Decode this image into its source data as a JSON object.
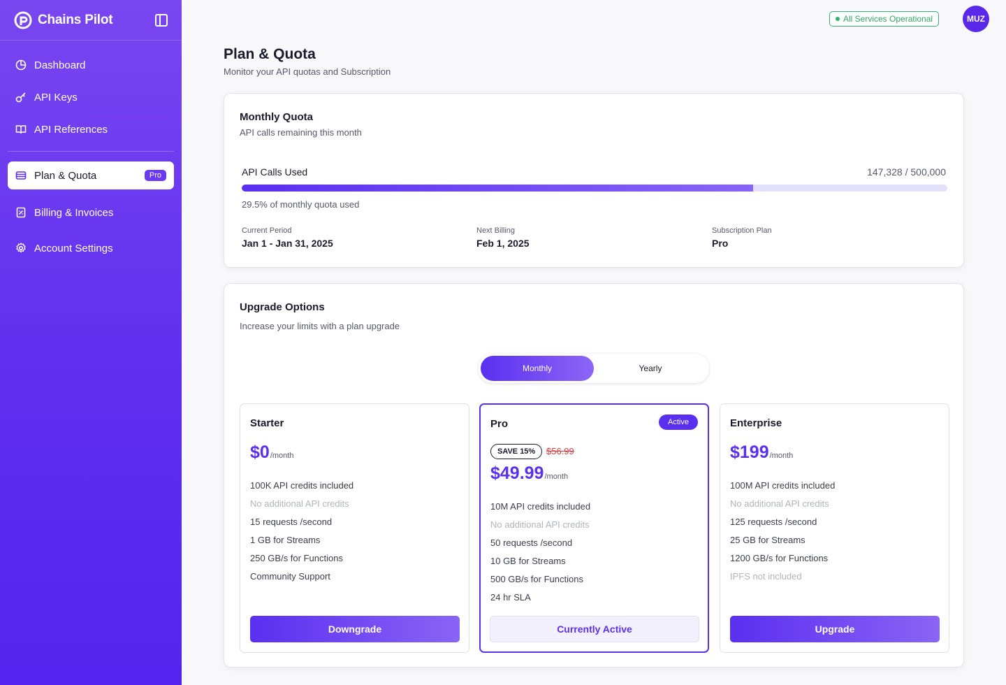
{
  "brand": {
    "name": "Chains Pilot"
  },
  "sidebar": {
    "items": [
      {
        "label": "Dashboard",
        "icon": "dashboard-icon"
      },
      {
        "label": "API Keys",
        "icon": "key-icon"
      },
      {
        "label": "API References",
        "icon": "book-icon"
      }
    ],
    "active_item": {
      "label": "Plan & Quota",
      "badge": "Pro",
      "icon": "plan-icon"
    },
    "items_bottom": [
      {
        "label": "Billing & Invoices",
        "icon": "invoice-icon"
      },
      {
        "label": "Account Settings",
        "icon": "gear-icon"
      }
    ]
  },
  "topbar": {
    "status": "All Services Operational",
    "avatar": "MUZ"
  },
  "header": {
    "title": "Plan & Quota",
    "subtitle": "Monitor your API quotas and Subscription"
  },
  "quota": {
    "title": "Monthly Quota",
    "subtitle": "API calls remaining this month",
    "calls_label": "API Calls Used",
    "calls_value": "147,328 / 500,000",
    "progress_fraction": 0.725,
    "percent_text": "29.5% of monthly quota used",
    "meta": [
      {
        "key": "Current Period",
        "value": "Jan 1 - Jan 31, 2025"
      },
      {
        "key": "Next Billing",
        "value": "Feb 1, 2025"
      },
      {
        "key": "Subscription Plan",
        "value": "Pro"
      }
    ]
  },
  "upgrade": {
    "title": "Upgrade Options",
    "subtitle": "Increase your limits with a plan upgrade",
    "toggle": {
      "monthly": "Monthly",
      "yearly": "Yearly",
      "selected": "Monthly"
    },
    "plans": [
      {
        "name": "Starter",
        "price": "$0",
        "per": "/month",
        "features": [
          "100K API credits included",
          "No additional API credits",
          "15 requests /second",
          "1 GB for Streams",
          "250 GB/s for Functions",
          "Community Support"
        ],
        "button": "Downgrade"
      },
      {
        "name": "Pro",
        "badge": "Active",
        "save": "SAVE 15%",
        "old_price": "$56.99",
        "price": "$49.99",
        "per": "/month",
        "features": [
          "10M API credits included",
          "No additional API credits",
          "50 requests /second",
          "10 GB for Streams",
          "500 GB/s for Functions",
          "24 hr SLA"
        ],
        "button": "Currently Active"
      },
      {
        "name": "Enterprise",
        "price": "$199",
        "per": "/month",
        "features": [
          "100M API credits included",
          "No additional API credits",
          "125 requests /second",
          "25 GB for Streams",
          "1200 GB/s for Functions",
          "IPFS not included"
        ],
        "button": "Upgrade"
      }
    ]
  },
  "colors": {
    "accent": "#5b2ff0",
    "status_green": "#2fb56a",
    "strike_red": "#e53a3a"
  }
}
